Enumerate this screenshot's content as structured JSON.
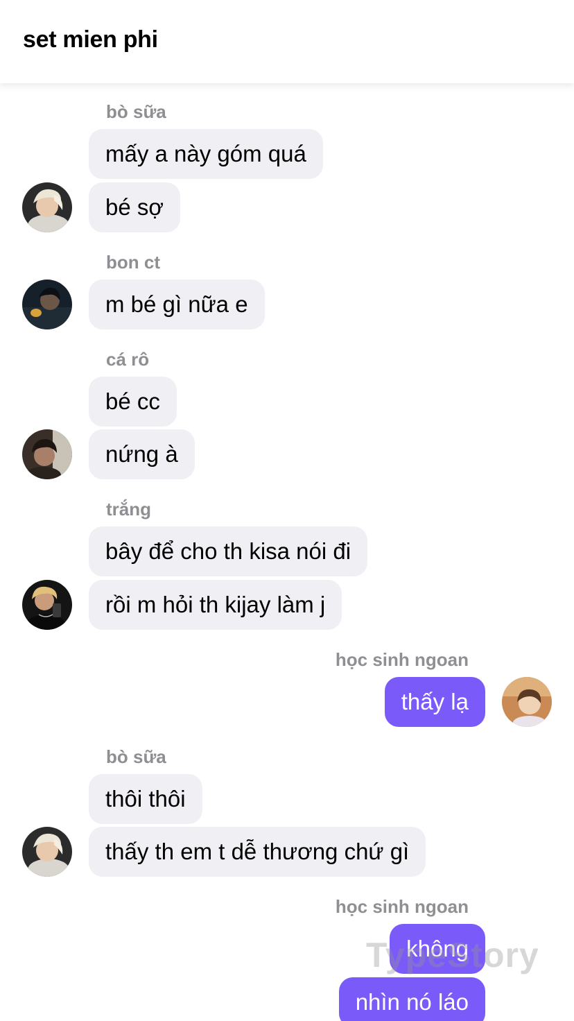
{
  "header": {
    "title": "set mien phi"
  },
  "messages": [
    {
      "name": "bò sữa",
      "texts": [
        "mấy a này góm quá",
        "bé sợ"
      ],
      "avatar": "avatar-photo-blonde"
    },
    {
      "name": "bon ct",
      "texts": [
        "m bé gì nữa e"
      ],
      "avatar": "avatar-photo-dark"
    },
    {
      "name": "cá rô",
      "texts": [
        "bé cc",
        "nứng à"
      ],
      "avatar": "avatar-photo-brown"
    },
    {
      "name": "trắng",
      "texts": [
        "bây để cho th kisa nói đi",
        "rồi m hỏi th kijay làm j"
      ],
      "avatar": "avatar-photo-mirror"
    },
    {
      "name": "học sinh ngoan",
      "texts": [
        "thấy lạ"
      ],
      "avatar": "avatar-photo-warm"
    },
    {
      "name": "bò sữa",
      "texts": [
        "thôi thôi",
        "thấy th em t dễ thương chứ gì"
      ],
      "avatar": "avatar-photo-blonde"
    },
    {
      "name": "học sinh ngoan",
      "texts": [
        "không",
        "nhìn nó láo"
      ]
    }
  ],
  "watermark": "TypeStory",
  "colors": {
    "incoming_bubble": "#efeff4",
    "outgoing_bubble": "#7a5af8",
    "sender_name": "#8e8e93"
  }
}
